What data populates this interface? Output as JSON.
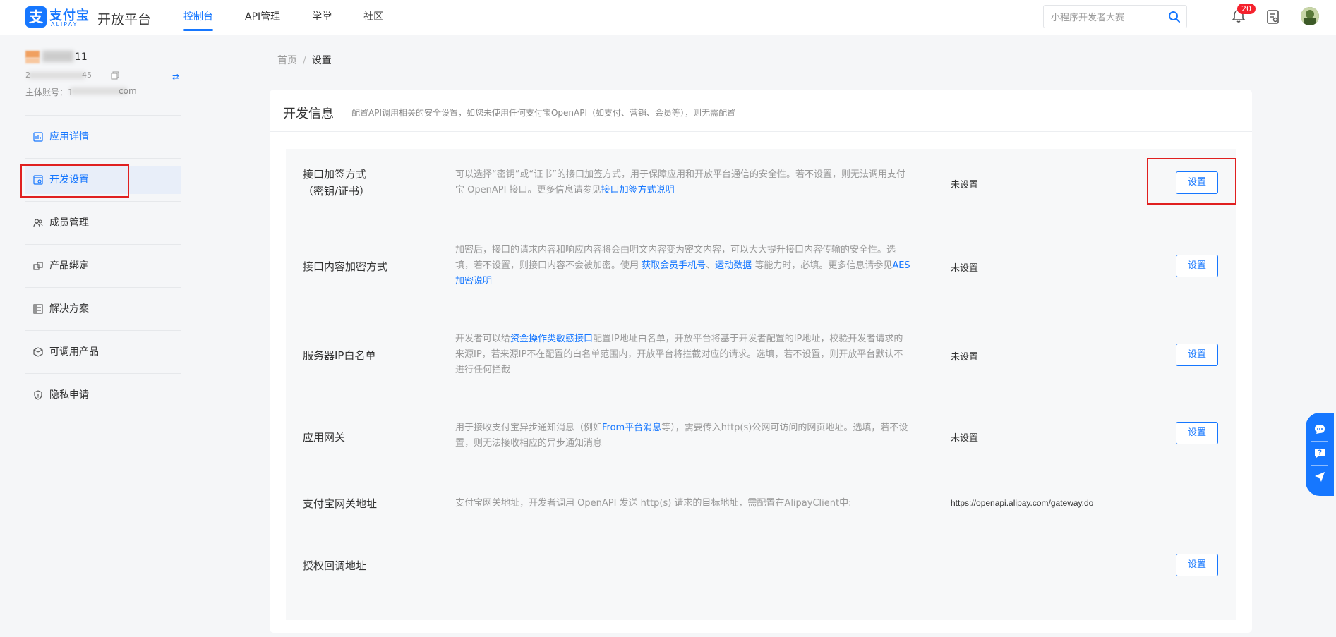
{
  "header": {
    "logo_text": "支付宝",
    "logo_sub": "ALIPAY",
    "platform_title": "开放平台",
    "nav": [
      {
        "label": "控制台",
        "active": true
      },
      {
        "label": "API管理",
        "active": false
      },
      {
        "label": "学堂",
        "active": false
      },
      {
        "label": "社区",
        "active": false
      }
    ],
    "search_placeholder": "小程序开发者大赛",
    "notification_count": "20",
    "accent_color": "#1677ff"
  },
  "sidebar": {
    "account_name_suffix": "11",
    "account_id_prefix": "2",
    "account_id_suffix": "45",
    "main_account_label": "主体账号：1",
    "main_account_suffix": "com",
    "items": [
      {
        "label": "应用详情",
        "icon": "chart-icon"
      },
      {
        "label": "开发设置",
        "icon": "settings-doc-icon",
        "active": true
      },
      {
        "label": "成员管理",
        "icon": "users-icon"
      },
      {
        "label": "产品绑定",
        "icon": "link-icon"
      },
      {
        "label": "解决方案",
        "icon": "solution-icon"
      },
      {
        "label": "可调用产品",
        "icon": "product-icon"
      },
      {
        "label": "隐私申请",
        "icon": "shield-icon"
      }
    ]
  },
  "breadcrumb": {
    "home": "首页",
    "separator": "/",
    "current": "设置"
  },
  "card": {
    "title": "开发信息",
    "description": "配置API调用相关的安全设置，如您未使用任何支付宝OpenAPI（如支付、营销、会员等），则无需配置"
  },
  "rows": [
    {
      "label_line1": "接口加签方式",
      "label_line2": "（密钥/证书）",
      "desc_text": "可以选择“密钥”或“证书”的接口加签方式，用于保障应用和开放平台通信的安全性。若不设置，则无法调用支付宝 OpenAPI 接口。更多信息请参见",
      "desc_link": "接口加签方式说明",
      "status": "未设置",
      "button": "设置"
    },
    {
      "label_line1": "接口内容加密方式",
      "desc_text": "加密后，接口的请求内容和响应内容将会由明文内容变为密文内容，可以大大提升接口内容传输的安全性。选填，若不设置，则接口内容不会被加密。使用 ",
      "desc_link1": "获取会员手机号",
      "desc_mid": "、",
      "desc_link2": "运动数据",
      "desc_text2": " 等能力时，必填。更多信息请参见",
      "desc_link3": "AES加密说明",
      "status": "未设置",
      "button": "设置"
    },
    {
      "label_line1": "服务器IP白名单",
      "desc_text": "开发者可以给",
      "desc_link": "资金操作类敏感接口",
      "desc_text2": "配置IP地址白名单，开放平台将基于开发者配置的IP地址，校验开发者请求的来源IP，若来源IP不在配置的白名单范围内，开放平台将拦截对应的请求。选填，若不设置，则开放平台默认不进行任何拦截",
      "status": "未设置",
      "button": "设置"
    },
    {
      "label_line1": "应用网关",
      "desc_text": "用于接收支付宝异步通知消息（例如",
      "desc_link": "From平台消息",
      "desc_text2": "等），需要传入http(s)公网可访问的网页地址。选填，若不设置，则无法接收相应的异步通知消息",
      "status": "未设置",
      "button": "设置"
    },
    {
      "label_line1": "支付宝网关地址",
      "desc_text": "支付宝网关地址，开发者调用 OpenAPI 发送 http(s) 请求的目标地址，需配置在AlipayClient中:",
      "url": "https://openapi.alipay.com/gateway.do"
    },
    {
      "label_line1": "授权回调地址",
      "button": "设置"
    }
  ]
}
